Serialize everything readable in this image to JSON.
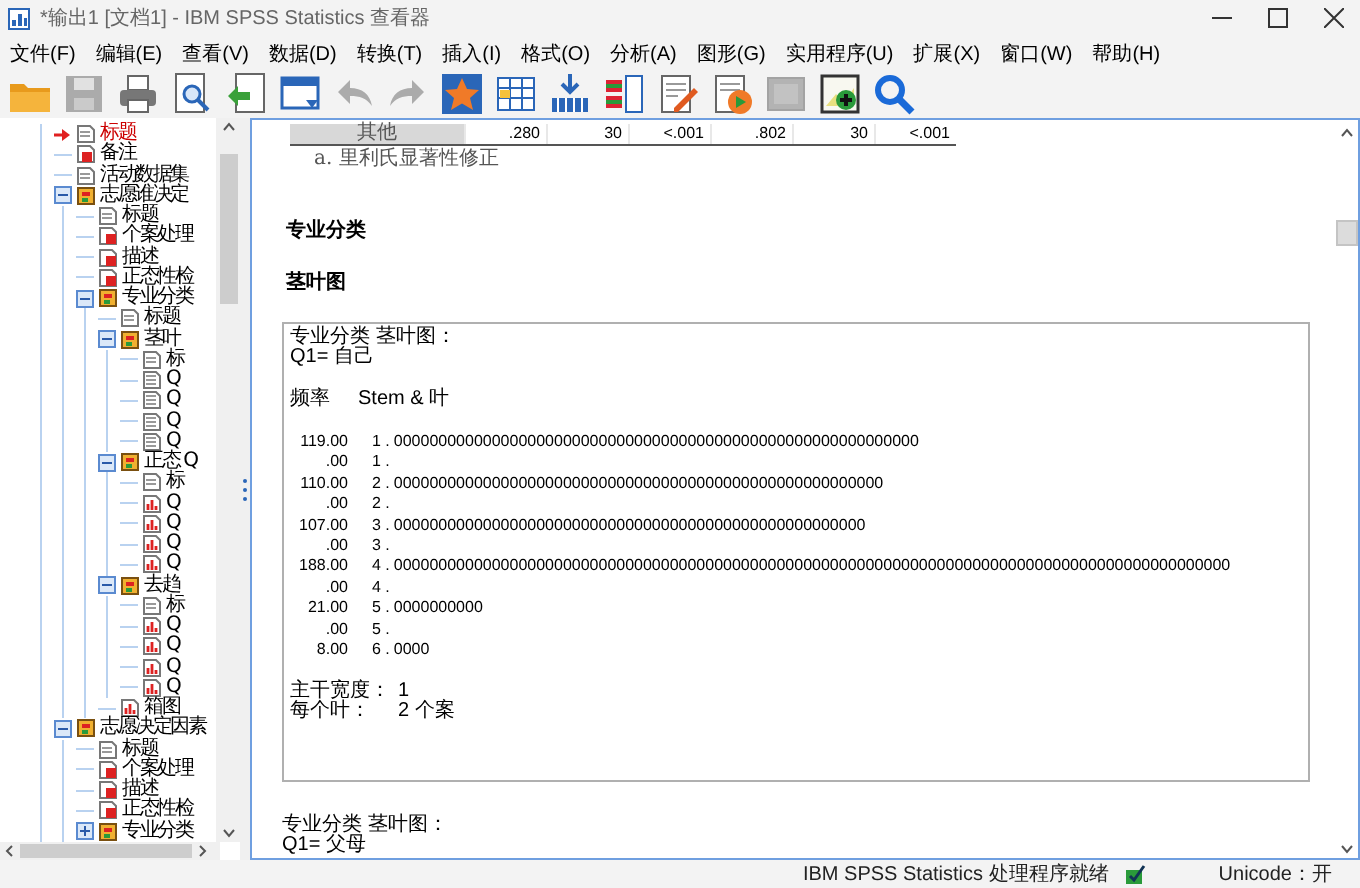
{
  "window": {
    "title": "*输出1 [文档1] - IBM SPSS Statistics 查看器"
  },
  "menu": [
    "文件(F)",
    "编辑(E)",
    "查看(V)",
    "数据(D)",
    "转换(T)",
    "插入(I)",
    "格式(O)",
    "分析(A)",
    "图形(G)",
    "实用程序(U)",
    "扩展(X)",
    "窗口(W)",
    "帮助(H)"
  ],
  "toolbar": [
    {
      "kind": "open",
      "disabled": false
    },
    {
      "kind": "save",
      "disabled": true
    },
    {
      "kind": "print",
      "disabled": false
    },
    {
      "kind": "preview",
      "disabled": false
    },
    {
      "kind": "export",
      "disabled": false
    },
    {
      "kind": "data",
      "disabled": false
    },
    {
      "kind": "undo",
      "disabled": true
    },
    {
      "kind": "redo",
      "disabled": true
    },
    {
      "kind": "star",
      "disabled": false
    },
    {
      "kind": "grid",
      "disabled": false
    },
    {
      "kind": "insert",
      "disabled": false
    },
    {
      "kind": "list",
      "disabled": false
    },
    {
      "kind": "edit",
      "disabled": false
    },
    {
      "kind": "run",
      "disabled": false
    },
    {
      "kind": "blank",
      "disabled": true
    },
    {
      "kind": "add",
      "disabled": false
    },
    {
      "kind": "search",
      "disabled": false
    }
  ],
  "outline": {
    "items": [
      {
        "label": "标题",
        "kind": "title",
        "current": true
      },
      {
        "label": "备注",
        "kind": "notes",
        "current": false
      },
      {
        "label": "活动数据集",
        "kind": "dataset",
        "current": false
      },
      {
        "label": "志愿谁决定",
        "kind": "heading",
        "current": false,
        "expanded": true,
        "children": [
          {
            "label": "标题",
            "kind": "title",
            "current": false
          },
          {
            "label": "个案处理",
            "kind": "table",
            "current": false
          },
          {
            "label": "描述",
            "kind": "table",
            "current": false
          },
          {
            "label": "正态性检",
            "kind": "table",
            "current": false
          },
          {
            "label": "专业分类",
            "kind": "heading",
            "current": false,
            "expanded": true,
            "children": [
              {
                "label": "标题",
                "kind": "title",
                "current": false
              },
              {
                "label": "茎叶",
                "kind": "heading",
                "current": false,
                "expanded": true,
                "children": [
                  {
                    "label": "标",
                    "kind": "title",
                    "current": false
                  },
                  {
                    "label": "Q",
                    "kind": "text",
                    "current": false
                  },
                  {
                    "label": "Q",
                    "kind": "text",
                    "current": false
                  },
                  {
                    "label": "Q",
                    "kind": "text",
                    "current": false
                  },
                  {
                    "label": "Q",
                    "kind": "text",
                    "current": false
                  }
                ]
              },
              {
                "label": "正态 Q",
                "kind": "heading",
                "current": false,
                "expanded": true,
                "children": [
                  {
                    "label": "标",
                    "kind": "title",
                    "current": false
                  },
                  {
                    "label": "Q",
                    "kind": "chart",
                    "current": false
                  },
                  {
                    "label": "Q",
                    "kind": "chart",
                    "current": false
                  },
                  {
                    "label": "Q",
                    "kind": "chart",
                    "current": false
                  },
                  {
                    "label": "Q",
                    "kind": "chart",
                    "current": false
                  }
                ]
              },
              {
                "label": "去趋",
                "kind": "heading",
                "current": false,
                "expanded": true,
                "children": [
                  {
                    "label": "标",
                    "kind": "title",
                    "current": false
                  },
                  {
                    "label": "Q",
                    "kind": "chart",
                    "current": false
                  },
                  {
                    "label": "Q",
                    "kind": "chart",
                    "current": false
                  },
                  {
                    "label": "Q",
                    "kind": "chart",
                    "current": false
                  },
                  {
                    "label": "Q",
                    "kind": "chart",
                    "current": false
                  }
                ]
              },
              {
                "label": "箱图",
                "kind": "chart",
                "current": false
              }
            ]
          }
        ]
      },
      {
        "label": "志愿决定因素",
        "kind": "heading",
        "current": false,
        "expanded": true,
        "children": [
          {
            "label": "标题",
            "kind": "title",
            "current": false
          },
          {
            "label": "个案处理",
            "kind": "table",
            "current": false
          },
          {
            "label": "描述",
            "kind": "table",
            "current": false
          },
          {
            "label": "正态性检",
            "kind": "table",
            "current": false
          },
          {
            "label": "专业分类",
            "kind": "heading",
            "current": false,
            "expanded": false
          }
        ]
      }
    ]
  },
  "output": [
    {
      "kind": "table_row",
      "header": "其他",
      "cells": [
        ".280",
        "30",
        "<.001",
        ".802",
        "30",
        "<.001"
      ]
    },
    {
      "kind": "footnote",
      "text": "a. 里利氏显著性修正"
    },
    {
      "kind": "heading",
      "text": "专业分类"
    },
    {
      "kind": "heading",
      "text": "茎叶图"
    },
    {
      "kind": "stem_leaf",
      "title": "专业分类 茎叶图：",
      "variable": "Q1= 自己",
      "frequency_header": "频率",
      "stem_header": "Stem &  叶",
      "rows": [
        {
          "frequency": "119.00",
          "stem": "1 .",
          "leaves": "00000000000000000000000000000000000000000000000000000000000"
        },
        {
          "frequency": ".00",
          "stem": "1 ."
        },
        {
          "frequency": "110.00",
          "stem": "2 .",
          "leaves": "0000000000000000000000000000000000000000000000000000000"
        },
        {
          "frequency": ".00",
          "stem": "2 ."
        },
        {
          "frequency": "107.00",
          "stem": "3 .",
          "leaves": "00000000000000000000000000000000000000000000000000000"
        },
        {
          "frequency": ".00",
          "stem": "3 ."
        },
        {
          "frequency": "188.00",
          "stem": "4 .",
          "leaves": "0000000000000000000000000000000000000000000000000000000000000000000000000000000000000000000000"
        },
        {
          "frequency": ".00",
          "stem": "4 ."
        },
        {
          "frequency": "21.00",
          "stem": "5 .",
          "leaves": "0000000000"
        },
        {
          "frequency": ".00",
          "stem": "5 ."
        },
        {
          "frequency": "8.00",
          "stem": "6 .",
          "leaves": "0000"
        }
      ],
      "footer": [
        {
          "label": "主干宽度：",
          "value": "1"
        },
        {
          "label": "每个叶：",
          "value": "2 个案"
        }
      ]
    },
    {
      "kind": "text",
      "lines": [
        "专业分类 茎叶图：",
        "Q1= 父母"
      ]
    }
  ],
  "status_bar": {
    "message": "IBM SPSS Statistics 处理程序就绪",
    "unicode": "Unicode：开"
  }
}
